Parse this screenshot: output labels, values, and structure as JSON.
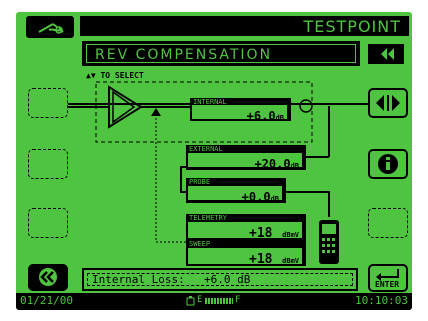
{
  "header": {
    "title": "TESTPOINT",
    "subtitle": "REV COMPENSATION",
    "select_hint": "TO SELECT"
  },
  "measurements": {
    "internal": {
      "label": "INTERNAL",
      "value": "+6.0",
      "unit": "dB"
    },
    "external": {
      "label": "EXTERNAL",
      "value": "+20.0",
      "unit": "dB"
    },
    "probe": {
      "label": "PROBE",
      "value": "+0.0",
      "unit": "dB"
    },
    "telemetry": {
      "label": "TELEMETRY",
      "value": "+18",
      "unit": "dBmV"
    },
    "sweep": {
      "label": "SWEEP",
      "value": "+18",
      "unit": "dBmV"
    }
  },
  "footer": {
    "internal_loss_label": "Internal Loss:",
    "internal_loss_value": "+6.0 dB",
    "enter_label": "ENTER",
    "date": "01/21/00",
    "time": "10:10:03",
    "battery_e": "E",
    "battery_f": "F"
  },
  "icons": {
    "logo": "probe-logo-icon",
    "back": "rewind-icon",
    "toggle": "diamond-arrows-icon",
    "info": "info-icon",
    "home": "double-chevron-left-icon",
    "enter": "enter-return-icon",
    "battery": "battery-icon"
  },
  "colors": {
    "lcd_green": "#4fc441",
    "foreground": "#000000"
  }
}
